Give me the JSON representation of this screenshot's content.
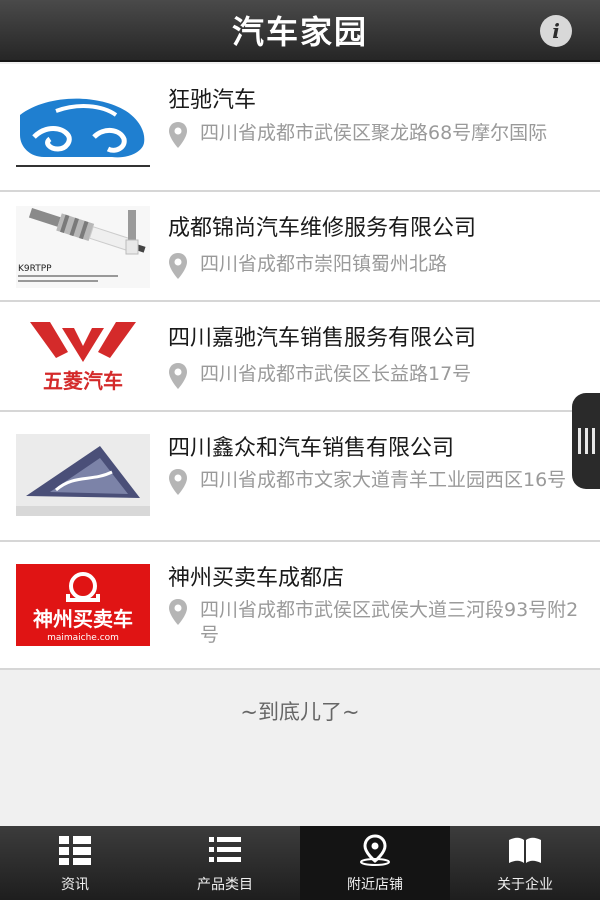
{
  "header": {
    "title": "汽车家园",
    "info_glyph": "i"
  },
  "stores": [
    {
      "name": "狂驰汽车",
      "address": "四川省成都市武侯区聚龙路68号摩尔国际",
      "thumb": "car-logo"
    },
    {
      "name": "成都锦尚汽车维修服务有限公司",
      "address": "四川省成都市崇阳镇蜀州北路",
      "thumb": "spark-plug",
      "thumb_text": "K9RTPP"
    },
    {
      "name": "四川嘉驰汽车销售服务有限公司",
      "address": "四川省成都市武侯区长益路17号",
      "thumb": "wuling-logo",
      "thumb_text": "五菱汽车"
    },
    {
      "name": "四川鑫众和汽车销售有限公司",
      "address": "四川省成都市文家大道青羊工业园西区16号",
      "thumb": "triangle-logo"
    },
    {
      "name": "神州买卖车成都店",
      "address": "四川省成都市武侯区武侯大道三河段93号附2号",
      "thumb": "maimaiche-logo",
      "thumb_text": "神州买卖车",
      "thumb_subtext": "maimaiche.com"
    }
  ],
  "end_text": "~到底儿了~",
  "tabs": [
    {
      "label": "资讯",
      "icon": "grid-list-icon",
      "active": false
    },
    {
      "label": "产品类目",
      "icon": "list-icon",
      "active": false
    },
    {
      "label": "附近店铺",
      "icon": "location-pin-icon",
      "active": true
    },
    {
      "label": "关于企业",
      "icon": "open-book-icon",
      "active": false
    }
  ],
  "colors": {
    "header_bg": "#333333",
    "name_text": "#1a1a1a",
    "address_text": "#9a9a9a",
    "wuling_red": "#d42a2a",
    "maimai_red": "#e01414"
  }
}
